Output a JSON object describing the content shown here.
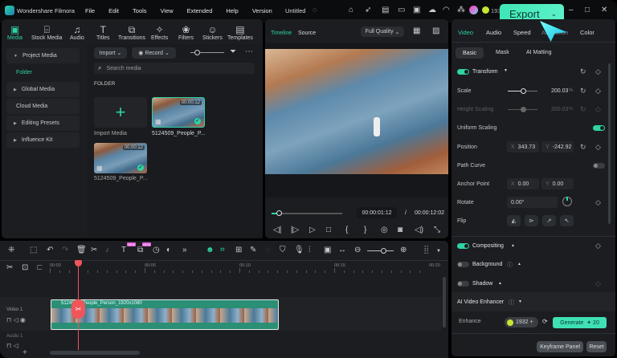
{
  "app": {
    "title": "Wondershare Filmora",
    "project": "Untitled",
    "menu": [
      "File",
      "Edit",
      "Tools",
      "View",
      "Extended",
      "Help",
      "Version"
    ],
    "credits": "193",
    "export_label": "Export"
  },
  "toolbar": [
    {
      "label": "Media",
      "icon": "media-icon"
    },
    {
      "label": "Stock Media",
      "icon": "stock-icon"
    },
    {
      "label": "Audio",
      "icon": "music-icon"
    },
    {
      "label": "Titles",
      "icon": "titles-icon"
    },
    {
      "label": "Transitions",
      "icon": "transitions-icon"
    },
    {
      "label": "Effects",
      "icon": "effects-icon"
    },
    {
      "label": "Filters",
      "icon": "filters-icon"
    },
    {
      "label": "Stickers",
      "icon": "stickers-icon"
    },
    {
      "label": "Templates",
      "icon": "templates-icon"
    }
  ],
  "sidebar": {
    "project_media": "Project Media",
    "folder": "Folder",
    "items": [
      "Global Media",
      "Cloud Media",
      "Editing Presets",
      "Influence Kit"
    ]
  },
  "media": {
    "import": "Import",
    "record": "Record",
    "search_placeholder": "Search media",
    "folder_heading": "FOLDER",
    "import_media": "Import Media",
    "clips": [
      {
        "name": "5124509_People_P...",
        "duration": "00:00:12"
      },
      {
        "name": "5124509_People_P...",
        "duration": "00:00:12"
      }
    ]
  },
  "preview": {
    "tabs": [
      "Timeline",
      "Source"
    ],
    "quality": "Full Quality",
    "current_time": "00:00:01:12",
    "separator": "/",
    "total_time": "00:00:12:02",
    "progress": 0.1
  },
  "props": {
    "tabs": [
      "Video",
      "Audio",
      "Speed",
      "Animation",
      "Color"
    ],
    "subtabs": [
      "Basic",
      "Mask",
      "AI Matting"
    ],
    "transform": "Transform",
    "scale_label": "Scale",
    "scale_value": "200.03",
    "pct": "%",
    "height_label": "Height Scaling",
    "height_value": "200.03",
    "uniform": "Uniform Scaling",
    "position_label": "Position",
    "x": "X",
    "y": "Y",
    "pos_x": "343.73",
    "pos_y": "-242.92",
    "path_curve": "Path Curve",
    "anchor_label": "Anchor Point",
    "anchor_x": "0.00",
    "anchor_y": "0.00",
    "rotate_label": "Rotate",
    "rotate_value": "0.00°",
    "flip_label": "Flip",
    "compositing": "Compositing",
    "background": "Background",
    "shadow": "Shadow",
    "ai_enhancer": "AI Video Enhancer",
    "enhance": "Enhance",
    "credits": "1932",
    "generate": "Generate",
    "generate_cost": "20",
    "keyframe": "Keyframe Panel",
    "reset": "Reset"
  },
  "timeline": {
    "ruler": [
      "00:00",
      "00:05",
      "00:10",
      "00:15",
      "00:20"
    ],
    "tracks": [
      "Video 1",
      "Audio 1"
    ],
    "clip_label": "5124509_People_Person_1920x1080",
    "badge": "NEW"
  },
  "colors": {
    "accent": "#2fd3a4",
    "playhead": "#f0555a",
    "bg": "#1b1d21"
  }
}
